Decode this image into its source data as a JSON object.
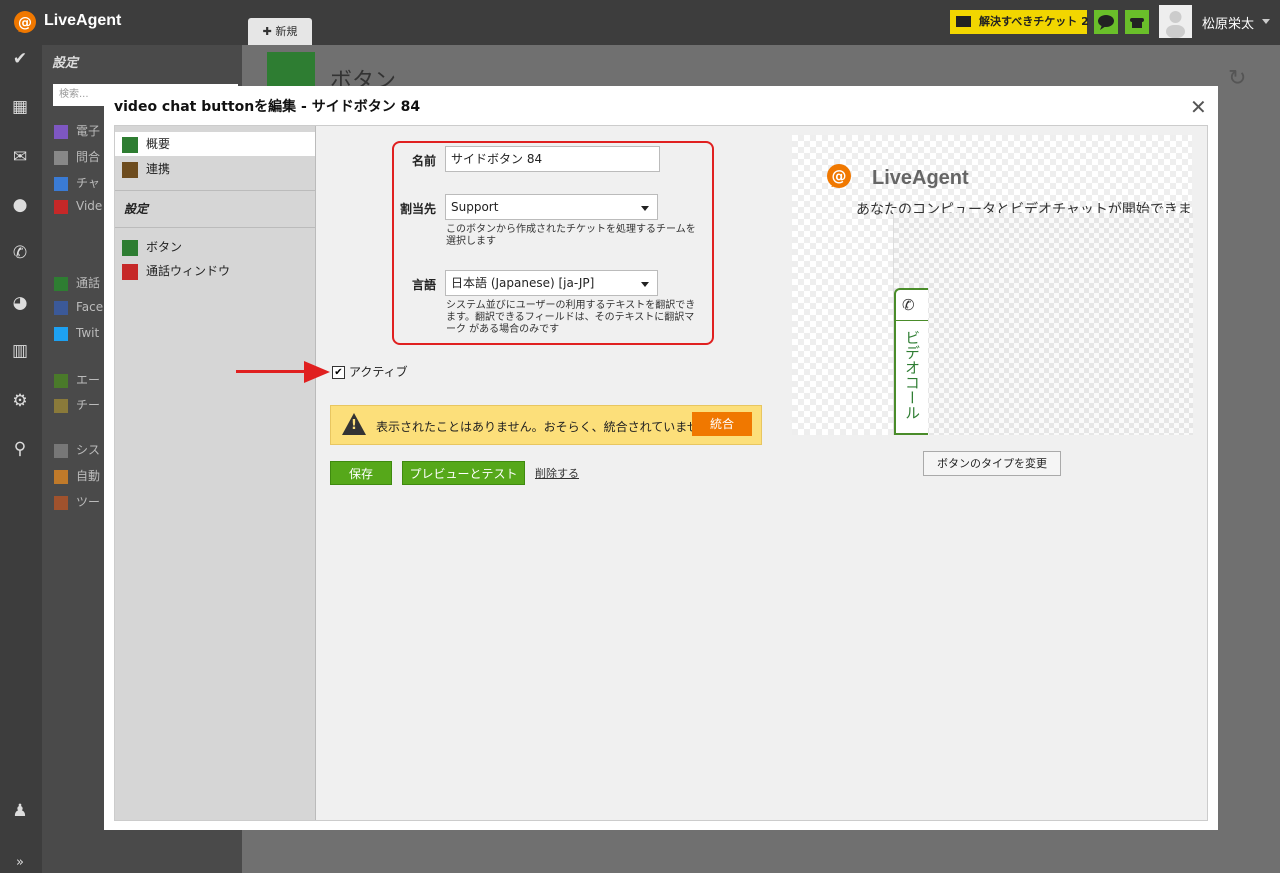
{
  "app": {
    "name": "LiveAgent",
    "new_tab": "新規"
  },
  "header": {
    "tickets_label": "解決すべきチケット",
    "tickets_count": "2",
    "user_name": "松原栄太"
  },
  "sidebar": {
    "title": "設定",
    "search_placeholder": "検索...",
    "items": [
      "電子",
      "問合",
      "チャ",
      "Vide",
      "通話",
      "Face",
      "Twit",
      "エー",
      "チー",
      "シス",
      "自動",
      "ツー"
    ]
  },
  "page": {
    "title": "ボタン"
  },
  "modal": {
    "title": "video chat buttonを編集 - サイドボタン 84",
    "nav": {
      "items": [
        "概要",
        "連携"
      ],
      "section": "設定",
      "sub_items": [
        "ボタン",
        "通話ウィンドウ"
      ]
    },
    "form": {
      "name_label": "名前",
      "name_value": "サイドボタン 84",
      "assign_label": "割当先",
      "assign_value": "Support",
      "assign_help": "このボタンから作成されたチケットを処理するチームを選択します",
      "lang_label": "言語",
      "lang_value": "日本語 (Japanese) [ja-JP]",
      "lang_help": "システム並びにユーザーの利用するテキストを翻訳できます。翻訳できるフィールドは、そのテキストに翻訳マーク がある場合のみです",
      "active_label": "アクティブ"
    },
    "warning": {
      "text": "表示されたことはありません。おそらく、統合されていません。",
      "button": "統合"
    },
    "buttons": {
      "save": "保存",
      "preview": "プレビューとテスト",
      "delete": "削除する"
    },
    "preview": {
      "logo_text": "LiveAgent",
      "subtitle": "あなたのコンピュータとビデオチャットが開始できます",
      "tab_text": "ビデオコール",
      "change_type": "ボタンのタイプを変更"
    }
  },
  "colors": {
    "brand_orange": "#f07800",
    "green": "#56a81a",
    "annotation_red": "#e02020",
    "ticket_yellow": "#f2d600"
  }
}
